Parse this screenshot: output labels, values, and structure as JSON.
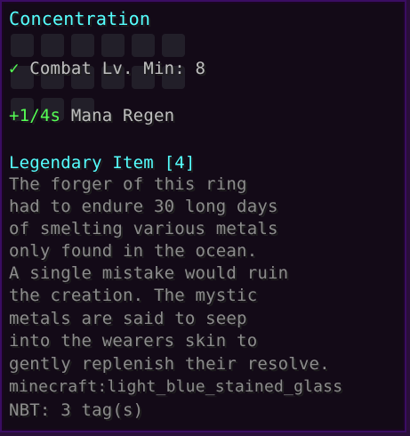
{
  "tooltip": {
    "title": "Concentration",
    "requirement": {
      "check": "✓",
      "text": "Combat Lv. Min: 8"
    },
    "stat": {
      "value": "+1/4s",
      "name": "Mana Regen"
    },
    "tier": "Legendary Item [4]",
    "lore": [
      "The forger of this ring",
      "had to endure 30 long days",
      "of smelting various metals",
      "only found in the ocean.",
      "A single mistake would ruin",
      "the creation. The mystic",
      "metals are said to seep",
      "into the wearers skin to",
      "gently replenish their resolve."
    ],
    "item_id": "minecraft:light_blue_stained_glass",
    "nbt": "NBT: 3 tag(s)"
  },
  "colors": {
    "background": "#130a17",
    "border": "#3a0d62",
    "title": "#55ffff",
    "green": "#55ff55",
    "lore": "#8c8c8c"
  }
}
